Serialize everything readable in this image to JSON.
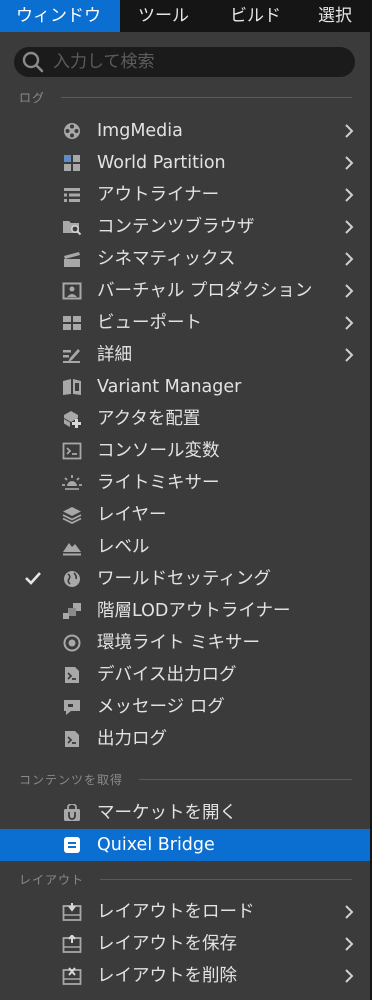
{
  "menubar": {
    "items": [
      {
        "label": "ウィンドウ"
      },
      {
        "label": "ツール"
      },
      {
        "label": "ビルド"
      },
      {
        "label": "選択"
      }
    ]
  },
  "search": {
    "placeholder": "入力して検索",
    "icon": "search-icon"
  },
  "sections": [
    {
      "title": "ログ"
    },
    {
      "title": "コンテンツを取得"
    },
    {
      "title": "レイアウト"
    }
  ],
  "items": [
    {
      "label": "ImgMedia",
      "icon": "film-reel-icon",
      "submenu": true
    },
    {
      "label": "World Partition",
      "icon": "grid-icon",
      "submenu": true
    },
    {
      "label": "アウトライナー",
      "icon": "outliner-icon",
      "submenu": true
    },
    {
      "label": "コンテンツブラウザ",
      "icon": "folder-search-icon",
      "submenu": true
    },
    {
      "label": "シネマティックス",
      "icon": "clapperboard-icon",
      "submenu": true
    },
    {
      "label": "バーチャル プロダクション",
      "icon": "virtual-production-icon",
      "submenu": true
    },
    {
      "label": "ビューポート",
      "icon": "viewport-icon",
      "submenu": true
    },
    {
      "label": "詳細",
      "icon": "details-pencil-icon",
      "submenu": true
    },
    {
      "label": "Variant Manager",
      "icon": "variant-book-icon",
      "submenu": false
    },
    {
      "label": "アクタを配置",
      "icon": "place-actor-icon",
      "submenu": false
    },
    {
      "label": "コンソール変数",
      "icon": "console-icon",
      "submenu": false
    },
    {
      "label": "ライトミキサー",
      "icon": "light-sun-icon",
      "submenu": false
    },
    {
      "label": "レイヤー",
      "icon": "layers-icon",
      "submenu": false
    },
    {
      "label": "レベル",
      "icon": "level-icon",
      "submenu": false
    },
    {
      "label": "ワールドセッティング",
      "icon": "globe-icon",
      "submenu": false,
      "checked": true
    },
    {
      "label": "階層LODアウトライナー",
      "icon": "hlod-icon",
      "submenu": false
    },
    {
      "label": "環境ライト ミキサー",
      "icon": "environment-light-icon",
      "submenu": false
    },
    {
      "label": "デバイス出力ログ",
      "icon": "log-document-icon",
      "submenu": false
    },
    {
      "label": "メッセージ ログ",
      "icon": "message-log-icon",
      "submenu": false
    },
    {
      "label": "出力ログ",
      "icon": "output-log-icon",
      "submenu": false
    },
    {
      "label": "マーケットを開く",
      "icon": "marketplace-bag-icon",
      "submenu": false
    },
    {
      "label": "Quixel Bridge",
      "icon": "bridge-icon",
      "submenu": false,
      "highlighted": true
    },
    {
      "label": "レイアウトをロード",
      "icon": "load-layout-icon",
      "submenu": true
    },
    {
      "label": "レイアウトを保存",
      "icon": "save-layout-icon",
      "submenu": true
    },
    {
      "label": "レイアウトを削除",
      "icon": "delete-layout-icon",
      "submenu": true
    }
  ],
  "colors": {
    "accent": "#0a6fd1",
    "menubar_bg": "#151515",
    "panel_bg": "#3b3b3b",
    "text": "#e2e2e2"
  }
}
